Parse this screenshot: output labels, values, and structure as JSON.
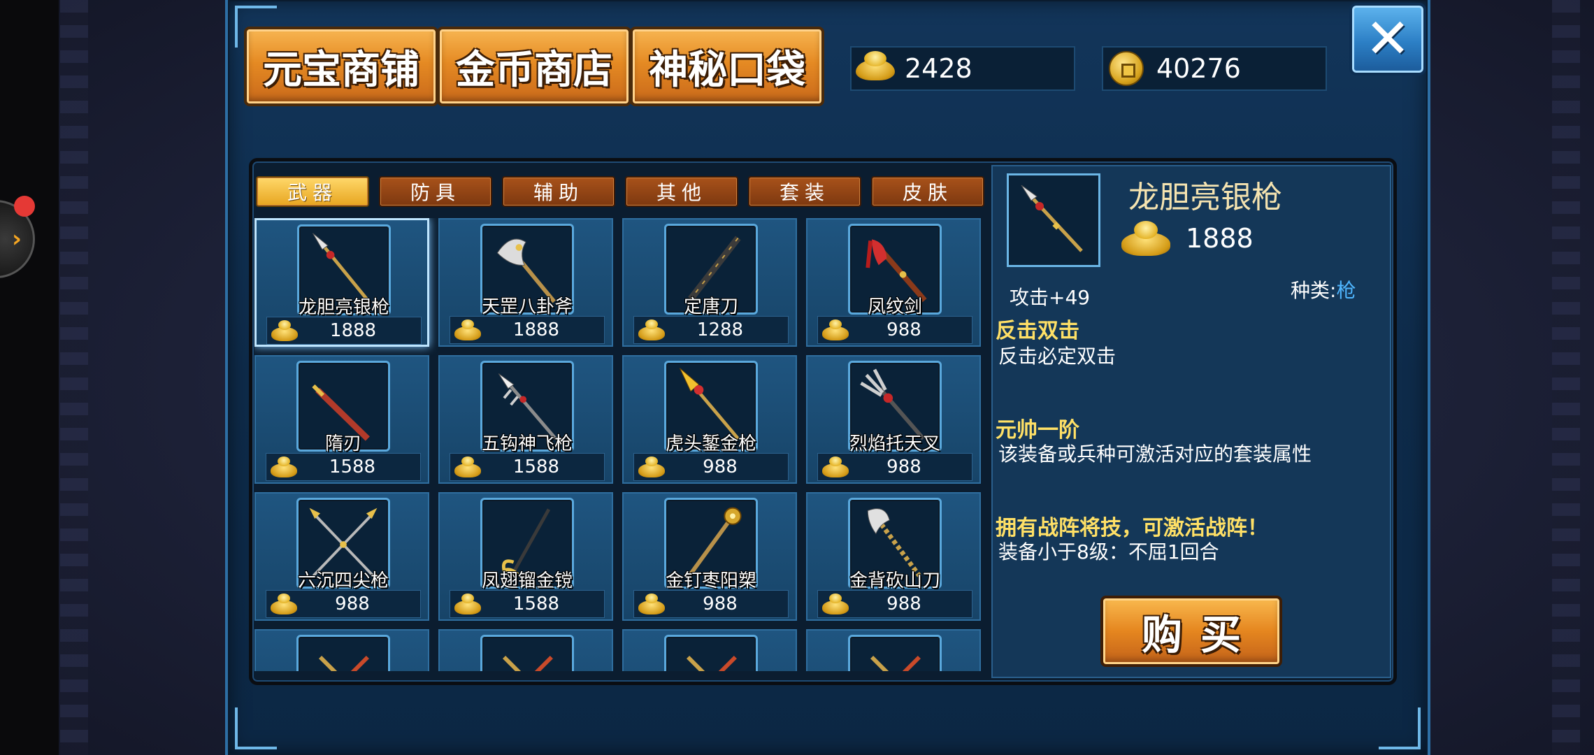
{
  "top_tabs": [
    {
      "label": "元宝商铺"
    },
    {
      "label": "金币商店"
    },
    {
      "label": "神秘口袋"
    }
  ],
  "currency": {
    "ingot": "2428",
    "coins": "40276"
  },
  "close_label": "✕",
  "categories": [
    {
      "label": "武器",
      "active": true
    },
    {
      "label": "防具",
      "active": false
    },
    {
      "label": "辅助",
      "active": false
    },
    {
      "label": "其他",
      "active": false
    },
    {
      "label": "套装",
      "active": false
    },
    {
      "label": "皮肤",
      "active": false
    }
  ],
  "items": [
    {
      "name": "龙胆亮银枪",
      "price": "1888",
      "icon": "spear-silver-icon",
      "selected": true
    },
    {
      "name": "天罡八卦斧",
      "price": "1888",
      "icon": "axe-icon"
    },
    {
      "name": "定唐刀",
      "price": "1288",
      "icon": "dark-blade-icon"
    },
    {
      "name": "凤纹剑",
      "price": "988",
      "icon": "phoenix-sword-icon"
    },
    {
      "name": "隋刃",
      "price": "1588",
      "icon": "red-blade-icon"
    },
    {
      "name": "五钩神飞枪",
      "price": "1588",
      "icon": "hook-spear-icon"
    },
    {
      "name": "虎头錾金枪",
      "price": "988",
      "icon": "tiger-spear-icon"
    },
    {
      "name": "烈焰托天叉",
      "price": "988",
      "icon": "trident-icon"
    },
    {
      "name": "六沉四尖枪",
      "price": "988",
      "icon": "crossed-spears-icon"
    },
    {
      "name": "凤翅镏金镋",
      "price": "1588",
      "icon": "polearm-icon"
    },
    {
      "name": "金钉枣阳槊",
      "price": "988",
      "icon": "mace-spear-icon"
    },
    {
      "name": "金背砍山刀",
      "price": "988",
      "icon": "glaive-icon"
    },
    {
      "name": "",
      "price": "",
      "icon": "partial-weapon-icon"
    },
    {
      "name": "",
      "price": "",
      "icon": "partial-weapon-icon"
    },
    {
      "name": "",
      "price": "",
      "icon": "partial-weapon-icon"
    },
    {
      "name": "",
      "price": "",
      "icon": "partial-weapon-icon"
    }
  ],
  "detail": {
    "name": "龙胆亮银枪",
    "price": "1888",
    "attack": "攻击+49",
    "type_label": "种类:",
    "type_value": "枪",
    "skill1_title": "反击双击",
    "skill1_desc": "反击必定双击",
    "skill2_title": "元帅一阶",
    "skill2_desc": "该装备或兵种可激活对应的套装属性",
    "skill3_title": "拥有战阵将技，可激活战阵！",
    "skill3_desc": "装备小于8级：不屈1回合",
    "buy_label": "购买"
  },
  "colors": {
    "accent_orange": "#e58a23",
    "panel_blue": "#12355a",
    "highlight_yellow": "#ffe066",
    "type_blue": "#4fb6ff"
  }
}
